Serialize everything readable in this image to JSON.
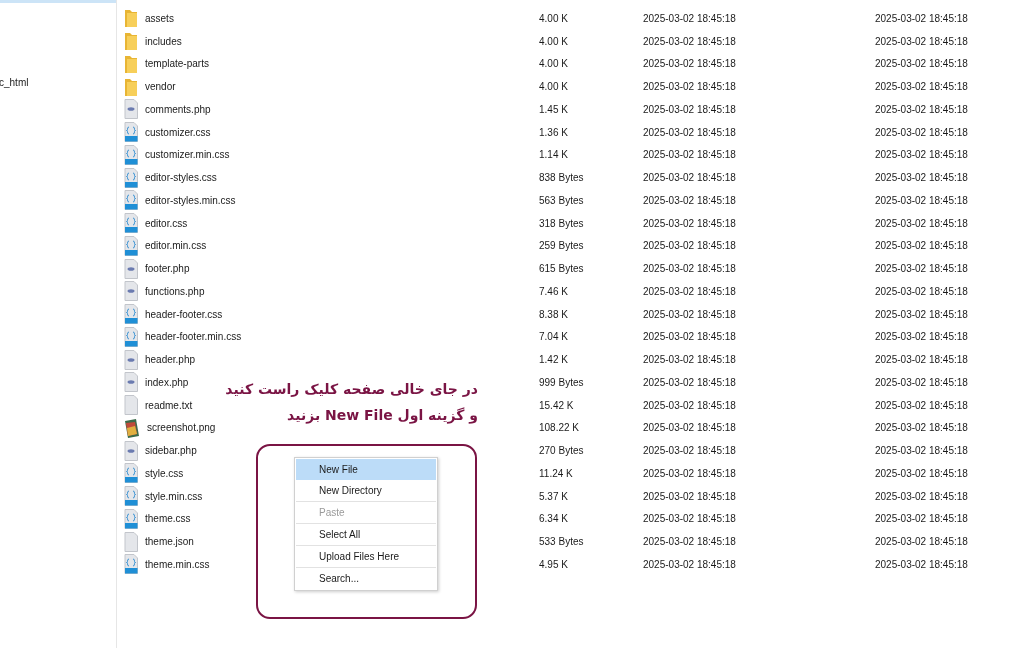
{
  "sidebar": {
    "items": [
      {
        "label": "c_html",
        "selected": false
      }
    ]
  },
  "files": [
    {
      "name": "assets",
      "kind": "folder",
      "size": "4.00 K",
      "modified": "2025-03-02 18:45:18",
      "created": "2025-03-02 18:45:18"
    },
    {
      "name": "includes",
      "kind": "folder",
      "size": "4.00 K",
      "modified": "2025-03-02 18:45:18",
      "created": "2025-03-02 18:45:18"
    },
    {
      "name": "template-parts",
      "kind": "folder",
      "size": "4.00 K",
      "modified": "2025-03-02 18:45:18",
      "created": "2025-03-02 18:45:18"
    },
    {
      "name": "vendor",
      "kind": "folder",
      "size": "4.00 K",
      "modified": "2025-03-02 18:45:18",
      "created": "2025-03-02 18:45:18"
    },
    {
      "name": "comments.php",
      "kind": "php",
      "size": "1.45 K",
      "modified": "2025-03-02 18:45:18",
      "created": "2025-03-02 18:45:18"
    },
    {
      "name": "customizer.css",
      "kind": "css",
      "size": "1.36 K",
      "modified": "2025-03-02 18:45:18",
      "created": "2025-03-02 18:45:18"
    },
    {
      "name": "customizer.min.css",
      "kind": "css",
      "size": "1.14 K",
      "modified": "2025-03-02 18:45:18",
      "created": "2025-03-02 18:45:18"
    },
    {
      "name": "editor-styles.css",
      "kind": "css",
      "size": "838 Bytes",
      "modified": "2025-03-02 18:45:18",
      "created": "2025-03-02 18:45:18"
    },
    {
      "name": "editor-styles.min.css",
      "kind": "css",
      "size": "563 Bytes",
      "modified": "2025-03-02 18:45:18",
      "created": "2025-03-02 18:45:18"
    },
    {
      "name": "editor.css",
      "kind": "css",
      "size": "318 Bytes",
      "modified": "2025-03-02 18:45:18",
      "created": "2025-03-02 18:45:18"
    },
    {
      "name": "editor.min.css",
      "kind": "css",
      "size": "259 Bytes",
      "modified": "2025-03-02 18:45:18",
      "created": "2025-03-02 18:45:18"
    },
    {
      "name": "footer.php",
      "kind": "php",
      "size": "615 Bytes",
      "modified": "2025-03-02 18:45:18",
      "created": "2025-03-02 18:45:18"
    },
    {
      "name": "functions.php",
      "kind": "php",
      "size": "7.46 K",
      "modified": "2025-03-02 18:45:18",
      "created": "2025-03-02 18:45:18"
    },
    {
      "name": "header-footer.css",
      "kind": "css",
      "size": "8.38 K",
      "modified": "2025-03-02 18:45:18",
      "created": "2025-03-02 18:45:18"
    },
    {
      "name": "header-footer.min.css",
      "kind": "css",
      "size": "7.04 K",
      "modified": "2025-03-02 18:45:18",
      "created": "2025-03-02 18:45:18"
    },
    {
      "name": "header.php",
      "kind": "php",
      "size": "1.42 K",
      "modified": "2025-03-02 18:45:18",
      "created": "2025-03-02 18:45:18"
    },
    {
      "name": "index.php",
      "kind": "php",
      "size": "999 Bytes",
      "modified": "2025-03-02 18:45:18",
      "created": "2025-03-02 18:45:18"
    },
    {
      "name": "readme.txt",
      "kind": "text",
      "size": "15.42 K",
      "modified": "2025-03-02 18:45:18",
      "created": "2025-03-02 18:45:18"
    },
    {
      "name": "screenshot.png",
      "kind": "image",
      "size": "108.22 K",
      "modified": "2025-03-02 18:45:18",
      "created": "2025-03-02 18:45:18"
    },
    {
      "name": "sidebar.php",
      "kind": "php",
      "size": "270 Bytes",
      "modified": "2025-03-02 18:45:18",
      "created": "2025-03-02 18:45:18"
    },
    {
      "name": "style.css",
      "kind": "css",
      "size": "11.24 K",
      "modified": "2025-03-02 18:45:18",
      "created": "2025-03-02 18:45:18"
    },
    {
      "name": "style.min.css",
      "kind": "css",
      "size": "5.37 K",
      "modified": "2025-03-02 18:45:18",
      "created": "2025-03-02 18:45:18"
    },
    {
      "name": "theme.css",
      "kind": "css",
      "size": "6.34 K",
      "modified": "2025-03-02 18:45:18",
      "created": "2025-03-02 18:45:18"
    },
    {
      "name": "theme.json",
      "kind": "text",
      "size": "533 Bytes",
      "modified": "2025-03-02 18:45:18",
      "created": "2025-03-02 18:45:18"
    },
    {
      "name": "theme.min.css",
      "kind": "css",
      "size": "4.95 K",
      "modified": "2025-03-02 18:45:18",
      "created": "2025-03-02 18:45:18"
    }
  ],
  "annotation": {
    "lines": [
      "در جای خالی صفحه کلیک راست کنید",
      "و گزینه اول New File بزنید"
    ]
  },
  "context_menu": {
    "groups": [
      [
        {
          "label": "New File",
          "highlighted": true,
          "disabled": false
        },
        {
          "label": "New Directory",
          "highlighted": false,
          "disabled": false
        }
      ],
      [
        {
          "label": "Paste",
          "highlighted": false,
          "disabled": true
        }
      ],
      [
        {
          "label": "Select All",
          "highlighted": false,
          "disabled": false
        }
      ],
      [
        {
          "label": "Upload Files Here",
          "highlighted": false,
          "disabled": false
        }
      ],
      [
        {
          "label": "Search...",
          "highlighted": false,
          "disabled": false
        }
      ]
    ]
  }
}
